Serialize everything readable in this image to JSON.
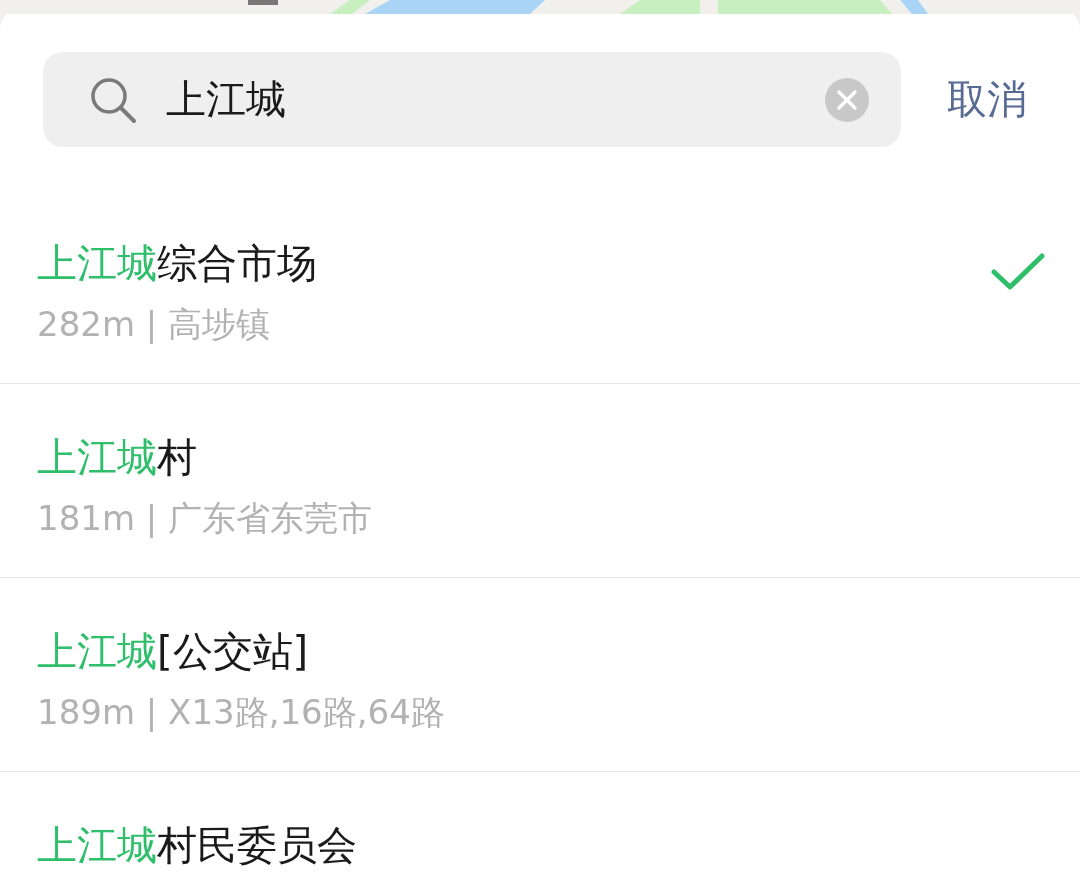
{
  "search": {
    "value": "上江城",
    "cancel": "取消"
  },
  "results": [
    {
      "match": "上江城",
      "rest": "综合市场",
      "detail": "282m | 高埗镇",
      "selected": true
    },
    {
      "match": "上江城",
      "rest": "村",
      "detail": "181m | 广东省东莞市",
      "selected": false
    },
    {
      "match": "上江城",
      "rest": "[公交站]",
      "detail": "189m | X13路,16路,64路",
      "selected": false
    },
    {
      "match": "上江城",
      "rest": "村民委员会",
      "selected": false
    }
  ]
}
